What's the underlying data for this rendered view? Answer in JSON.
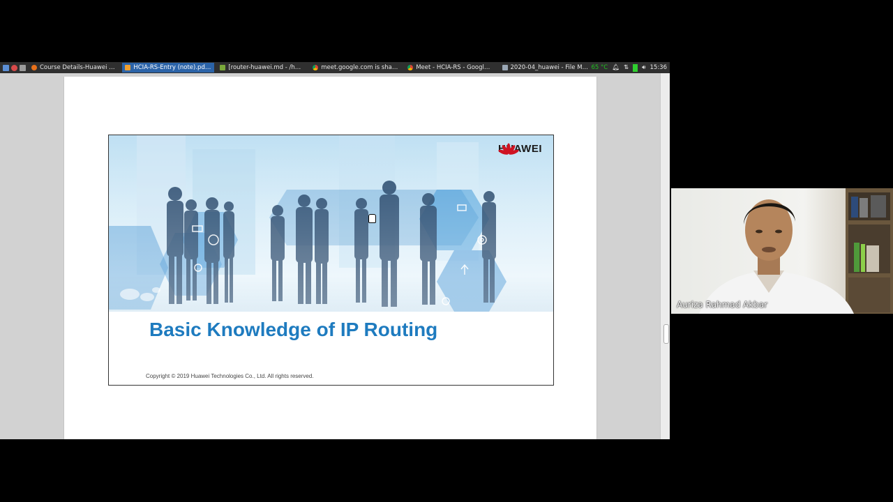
{
  "taskbar": {
    "tasks": [
      {
        "label": "Course Details-Huawei Tal...",
        "active": false,
        "icon": "firefox-icon",
        "color": "#e8701a"
      },
      {
        "label": "HCIA-RS-Entry (note).pdf - ...",
        "active": true,
        "icon": "pdf-icon",
        "color": "#f0a030"
      },
      {
        "label": "[router-huawei.md - /hom...",
        "active": false,
        "icon": "editor-icon",
        "color": "#7aa83a"
      },
      {
        "label": "meet.google.com is sharin...",
        "active": false,
        "icon": "chrome-icon",
        "color": "#4caf50"
      },
      {
        "label": "Meet - HCIA-RS - Google C...",
        "active": false,
        "icon": "chrome-icon",
        "color": "#4caf50"
      },
      {
        "label": "2020-04_huawei - File Man...",
        "active": false,
        "icon": "folder-icon",
        "color": "#9aa7b5"
      }
    ],
    "temperature": "65 °C",
    "time": "15:36"
  },
  "slide": {
    "brand": "HUAWEI",
    "title": "Basic Knowledge of IP Routing",
    "copyright": "Copyright © 2019 Huawei Technologies Co., Ltd. All rights reserved."
  },
  "webcam": {
    "participant_name": "Auriza Rahmad Akbar"
  },
  "colors": {
    "taskbar_bg": "#2f2f2f",
    "active_task": "#2b63a8",
    "title_blue": "#1e7bbf",
    "huawei_red": "#cf1322"
  }
}
